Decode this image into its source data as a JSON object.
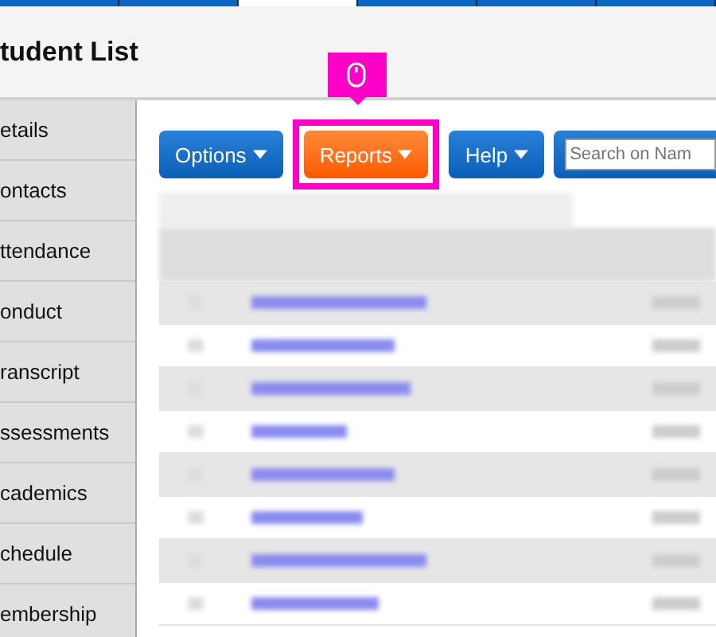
{
  "top_tabs": [
    {
      "selected": false
    },
    {
      "selected": false
    },
    {
      "selected": true
    },
    {
      "selected": false
    },
    {
      "selected": false
    },
    {
      "selected": false
    }
  ],
  "page_title": "tudent List",
  "sidebar": {
    "items": [
      {
        "label": "etails"
      },
      {
        "label": "ontacts"
      },
      {
        "label": "ttendance"
      },
      {
        "label": "onduct"
      },
      {
        "label": "ranscript"
      },
      {
        "label": "ssessments"
      },
      {
        "label": "cademics"
      },
      {
        "label": "chedule"
      },
      {
        "label": "embership"
      }
    ]
  },
  "toolbar": {
    "buttons": [
      {
        "label": "Options",
        "kind": "blue",
        "highlighted": false
      },
      {
        "label": "Reports",
        "kind": "orange",
        "highlighted": true
      },
      {
        "label": "Help",
        "kind": "blue",
        "highlighted": false
      }
    ],
    "search": {
      "placeholder": "Search on Nam"
    }
  },
  "table": {
    "rows": [
      {
        "shaded": true
      },
      {
        "shaded": false
      },
      {
        "shaded": true
      },
      {
        "shaded": false
      },
      {
        "shaded": true
      },
      {
        "shaded": false
      },
      {
        "shaded": true
      },
      {
        "shaded": false
      }
    ]
  }
}
